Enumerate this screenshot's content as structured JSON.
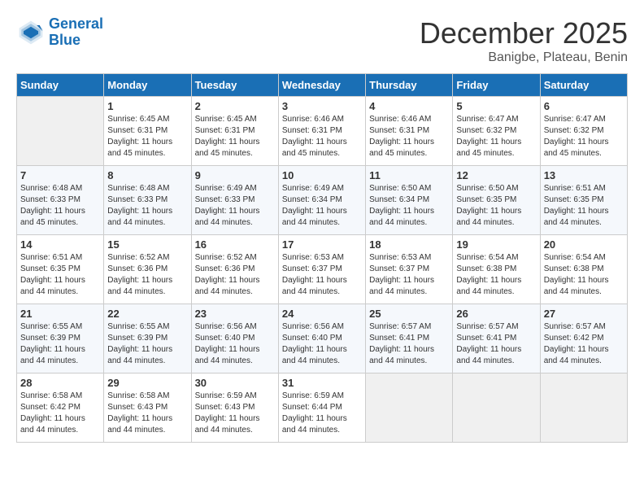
{
  "header": {
    "logo_line1": "General",
    "logo_line2": "Blue",
    "month": "December 2025",
    "location": "Banigbe, Plateau, Benin"
  },
  "days_of_week": [
    "Sunday",
    "Monday",
    "Tuesday",
    "Wednesday",
    "Thursday",
    "Friday",
    "Saturday"
  ],
  "weeks": [
    [
      {
        "day": "",
        "info": ""
      },
      {
        "day": "1",
        "info": "Sunrise: 6:45 AM\nSunset: 6:31 PM\nDaylight: 11 hours\nand 45 minutes."
      },
      {
        "day": "2",
        "info": "Sunrise: 6:45 AM\nSunset: 6:31 PM\nDaylight: 11 hours\nand 45 minutes."
      },
      {
        "day": "3",
        "info": "Sunrise: 6:46 AM\nSunset: 6:31 PM\nDaylight: 11 hours\nand 45 minutes."
      },
      {
        "day": "4",
        "info": "Sunrise: 6:46 AM\nSunset: 6:31 PM\nDaylight: 11 hours\nand 45 minutes."
      },
      {
        "day": "5",
        "info": "Sunrise: 6:47 AM\nSunset: 6:32 PM\nDaylight: 11 hours\nand 45 minutes."
      },
      {
        "day": "6",
        "info": "Sunrise: 6:47 AM\nSunset: 6:32 PM\nDaylight: 11 hours\nand 45 minutes."
      }
    ],
    [
      {
        "day": "7",
        "info": "Sunrise: 6:48 AM\nSunset: 6:33 PM\nDaylight: 11 hours\nand 45 minutes."
      },
      {
        "day": "8",
        "info": "Sunrise: 6:48 AM\nSunset: 6:33 PM\nDaylight: 11 hours\nand 44 minutes."
      },
      {
        "day": "9",
        "info": "Sunrise: 6:49 AM\nSunset: 6:33 PM\nDaylight: 11 hours\nand 44 minutes."
      },
      {
        "day": "10",
        "info": "Sunrise: 6:49 AM\nSunset: 6:34 PM\nDaylight: 11 hours\nand 44 minutes."
      },
      {
        "day": "11",
        "info": "Sunrise: 6:50 AM\nSunset: 6:34 PM\nDaylight: 11 hours\nand 44 minutes."
      },
      {
        "day": "12",
        "info": "Sunrise: 6:50 AM\nSunset: 6:35 PM\nDaylight: 11 hours\nand 44 minutes."
      },
      {
        "day": "13",
        "info": "Sunrise: 6:51 AM\nSunset: 6:35 PM\nDaylight: 11 hours\nand 44 minutes."
      }
    ],
    [
      {
        "day": "14",
        "info": "Sunrise: 6:51 AM\nSunset: 6:35 PM\nDaylight: 11 hours\nand 44 minutes."
      },
      {
        "day": "15",
        "info": "Sunrise: 6:52 AM\nSunset: 6:36 PM\nDaylight: 11 hours\nand 44 minutes."
      },
      {
        "day": "16",
        "info": "Sunrise: 6:52 AM\nSunset: 6:36 PM\nDaylight: 11 hours\nand 44 minutes."
      },
      {
        "day": "17",
        "info": "Sunrise: 6:53 AM\nSunset: 6:37 PM\nDaylight: 11 hours\nand 44 minutes."
      },
      {
        "day": "18",
        "info": "Sunrise: 6:53 AM\nSunset: 6:37 PM\nDaylight: 11 hours\nand 44 minutes."
      },
      {
        "day": "19",
        "info": "Sunrise: 6:54 AM\nSunset: 6:38 PM\nDaylight: 11 hours\nand 44 minutes."
      },
      {
        "day": "20",
        "info": "Sunrise: 6:54 AM\nSunset: 6:38 PM\nDaylight: 11 hours\nand 44 minutes."
      }
    ],
    [
      {
        "day": "21",
        "info": "Sunrise: 6:55 AM\nSunset: 6:39 PM\nDaylight: 11 hours\nand 44 minutes."
      },
      {
        "day": "22",
        "info": "Sunrise: 6:55 AM\nSunset: 6:39 PM\nDaylight: 11 hours\nand 44 minutes."
      },
      {
        "day": "23",
        "info": "Sunrise: 6:56 AM\nSunset: 6:40 PM\nDaylight: 11 hours\nand 44 minutes."
      },
      {
        "day": "24",
        "info": "Sunrise: 6:56 AM\nSunset: 6:40 PM\nDaylight: 11 hours\nand 44 minutes."
      },
      {
        "day": "25",
        "info": "Sunrise: 6:57 AM\nSunset: 6:41 PM\nDaylight: 11 hours\nand 44 minutes."
      },
      {
        "day": "26",
        "info": "Sunrise: 6:57 AM\nSunset: 6:41 PM\nDaylight: 11 hours\nand 44 minutes."
      },
      {
        "day": "27",
        "info": "Sunrise: 6:57 AM\nSunset: 6:42 PM\nDaylight: 11 hours\nand 44 minutes."
      }
    ],
    [
      {
        "day": "28",
        "info": "Sunrise: 6:58 AM\nSunset: 6:42 PM\nDaylight: 11 hours\nand 44 minutes."
      },
      {
        "day": "29",
        "info": "Sunrise: 6:58 AM\nSunset: 6:43 PM\nDaylight: 11 hours\nand 44 minutes."
      },
      {
        "day": "30",
        "info": "Sunrise: 6:59 AM\nSunset: 6:43 PM\nDaylight: 11 hours\nand 44 minutes."
      },
      {
        "day": "31",
        "info": "Sunrise: 6:59 AM\nSunset: 6:44 PM\nDaylight: 11 hours\nand 44 minutes."
      },
      {
        "day": "",
        "info": ""
      },
      {
        "day": "",
        "info": ""
      },
      {
        "day": "",
        "info": ""
      }
    ]
  ]
}
